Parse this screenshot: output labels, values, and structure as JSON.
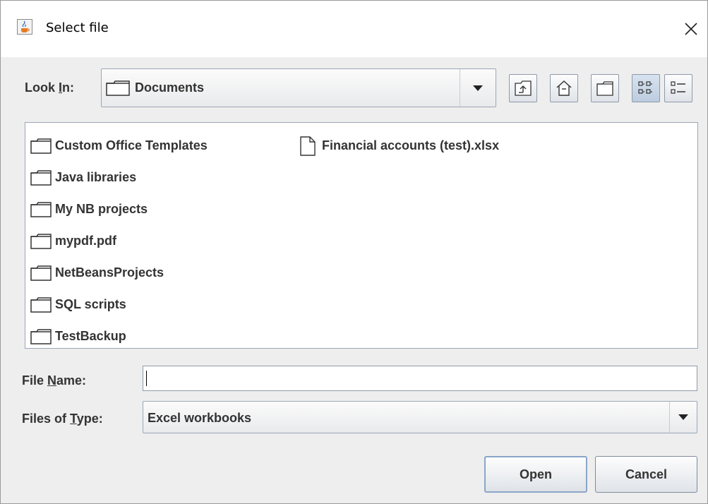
{
  "window": {
    "title": "Select file",
    "close_symbol": "×",
    "title_icon": "java-cup-icon"
  },
  "look_in": {
    "label_prefix": "Look ",
    "label_mnemonic": "I",
    "label_suffix": "n:",
    "value": "Documents",
    "icon": "folder-icon"
  },
  "toolbar": {
    "buttons": [
      {
        "name": "up-one-level-button",
        "icon": "up-folder-icon"
      },
      {
        "name": "home-button",
        "icon": "home-icon"
      },
      {
        "name": "create-new-folder-button",
        "icon": "new-folder-icon"
      },
      {
        "name": "list-view-button",
        "icon": "list-view-icon",
        "selected": true
      },
      {
        "name": "details-view-button",
        "icon": "details-view-icon",
        "selected": false
      }
    ]
  },
  "files": {
    "column1": [
      {
        "name": "Custom Office Templates",
        "type": "folder"
      },
      {
        "name": "Java libraries",
        "type": "folder"
      },
      {
        "name": "My NB projects",
        "type": "folder"
      },
      {
        "name": "mypdf.pdf",
        "type": "folder"
      },
      {
        "name": "NetBeansProjects",
        "type": "folder"
      },
      {
        "name": "SQL scripts",
        "type": "folder"
      },
      {
        "name": "TestBackup",
        "type": "folder"
      }
    ],
    "column2": [
      {
        "name": "Financial accounts (test).xlsx",
        "type": "file"
      }
    ]
  },
  "file_name": {
    "label_prefix": "File ",
    "label_mnemonic": "N",
    "label_suffix": "ame:",
    "value": "",
    "placeholder": ""
  },
  "file_type": {
    "label_prefix": "Files of ",
    "label_mnemonic": "T",
    "label_suffix": "ype:",
    "value": "Excel workbooks"
  },
  "buttons": {
    "open": "Open",
    "cancel": "Cancel"
  },
  "colors": {
    "dialog_bg": "#eeeeee",
    "border": "#9aa7b6",
    "selected_view": "#c7d5e6"
  }
}
